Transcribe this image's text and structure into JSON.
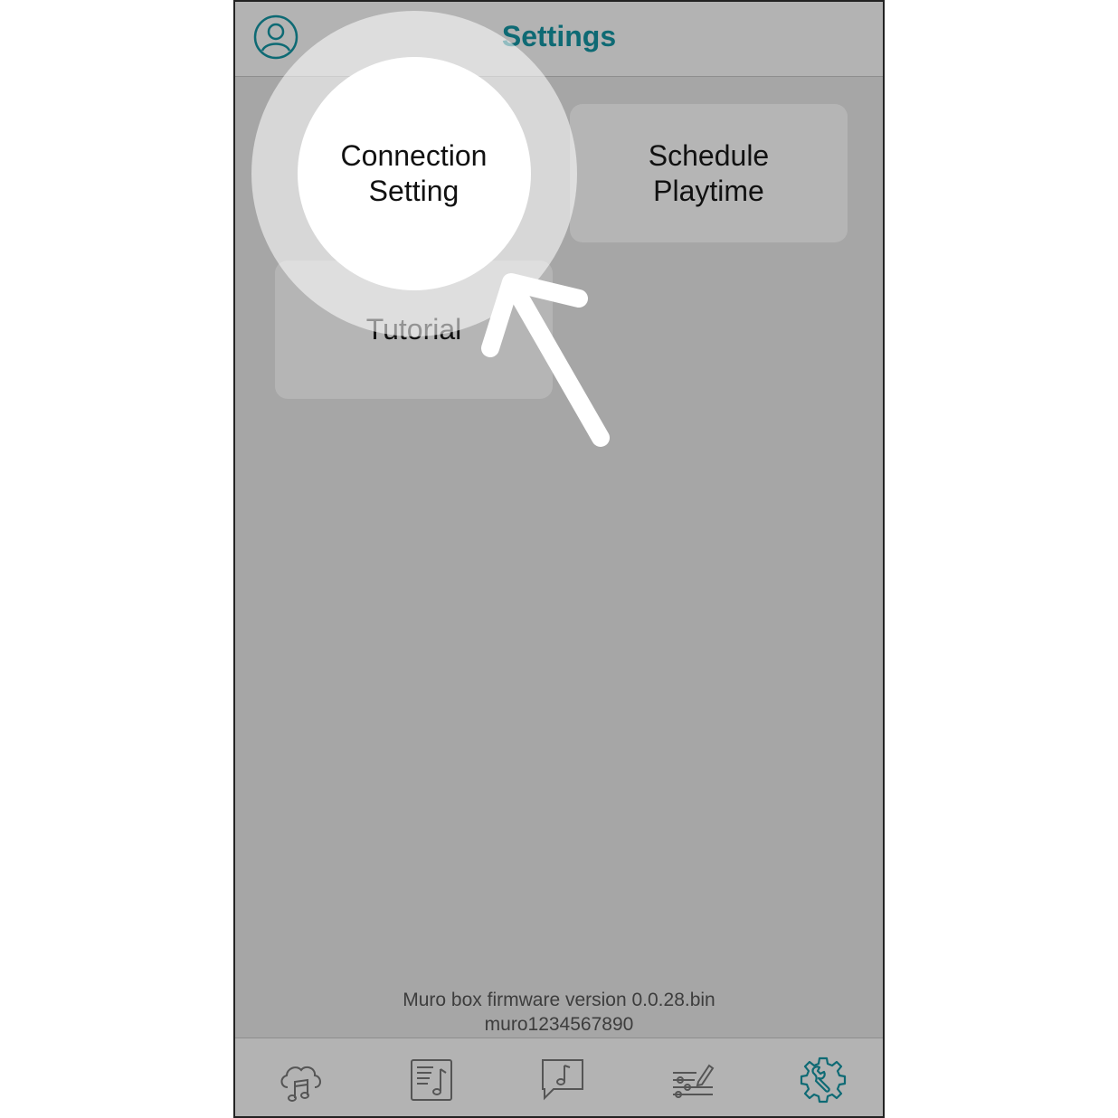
{
  "header": {
    "title": "Settings"
  },
  "tiles": [
    {
      "label": "Connection\nSetting",
      "highlighted": true
    },
    {
      "label": "Schedule\nPlaytime",
      "highlighted": false
    },
    {
      "label": "Tutorial",
      "highlighted": false
    }
  ],
  "footer": {
    "firmware": "Muro box firmware version 0.0.28.bin",
    "device_id": "muro1234567890"
  },
  "tabbar": {
    "items": [
      {
        "icon": "cloud-music-icon",
        "active": false
      },
      {
        "icon": "music-sheet-icon",
        "active": false
      },
      {
        "icon": "music-message-icon",
        "active": false
      },
      {
        "icon": "equalizer-edit-icon",
        "active": false
      },
      {
        "icon": "gear-wrench-icon",
        "active": true
      }
    ]
  },
  "colors": {
    "accent": "#0e6a74",
    "overlay": "#a6a6a6",
    "tile": "#b5b5b5",
    "icon_inactive": "#555555"
  }
}
